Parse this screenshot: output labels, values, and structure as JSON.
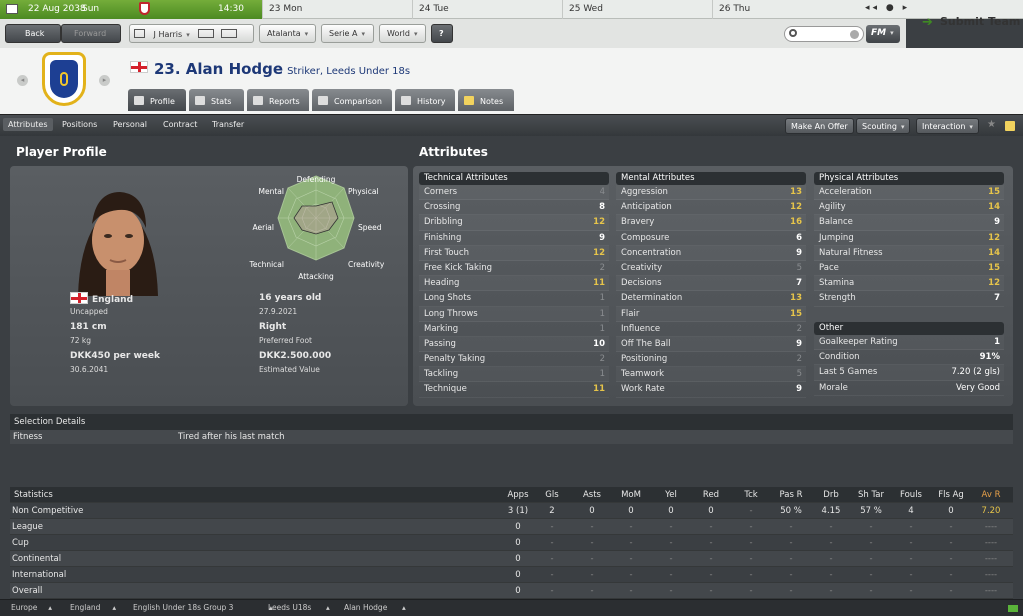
{
  "calendar": {
    "current_date": "22 Aug 2038",
    "current_day": "Sun",
    "time": "14:30",
    "days": [
      "23 Mon",
      "24 Tue",
      "25 Wed",
      "26 Thu"
    ]
  },
  "toolbar": {
    "back": "Back",
    "forward": "Forward",
    "manager": "J Harris",
    "club": "Atalanta",
    "league": "Serie A",
    "world": "World",
    "help": "?",
    "fm": "FM",
    "submit": "Submit Team"
  },
  "player": {
    "number_name": "23. Alan Hodge",
    "subtitle": "Striker, Leeds Under 18s"
  },
  "tabs": [
    "Profile",
    "Stats",
    "Reports",
    "Comparison",
    "History",
    "Notes"
  ],
  "subnav": {
    "items": [
      "Attributes",
      "Positions",
      "Personal",
      "Contract",
      "Transfer"
    ],
    "make_offer": "Make An Offer",
    "scouting": "Scouting",
    "interaction": "Interaction"
  },
  "profile": {
    "title": "Player Profile",
    "nation": "England",
    "caps": "Uncapped",
    "age": "16 years old",
    "dob": "27.9.2021",
    "height": "181 cm",
    "weight": "72 kg",
    "foot": "Right",
    "foot_label": "Preferred Foot",
    "wage": "DKK450 per week",
    "contract": "30.6.2041",
    "value": "DKK2.500.000",
    "value_label": "Estimated Value",
    "radar": {
      "labels": [
        "Defending",
        "Physical",
        "Speed",
        "Creativity",
        "Attacking",
        "Technical",
        "Aerial",
        "Mental"
      ]
    }
  },
  "attributes": {
    "title": "Attributes",
    "technical": {
      "header": "Technical Attributes",
      "items": [
        {
          "name": "Corners",
          "value": "4"
        },
        {
          "name": "Crossing",
          "value": "8"
        },
        {
          "name": "Dribbling",
          "value": "12"
        },
        {
          "name": "Finishing",
          "value": "9"
        },
        {
          "name": "First Touch",
          "value": "12"
        },
        {
          "name": "Free Kick Taking",
          "value": "2"
        },
        {
          "name": "Heading",
          "value": "11"
        },
        {
          "name": "Long Shots",
          "value": "1"
        },
        {
          "name": "Long Throws",
          "value": "1"
        },
        {
          "name": "Marking",
          "value": "1"
        },
        {
          "name": "Passing",
          "value": "10"
        },
        {
          "name": "Penalty Taking",
          "value": "2"
        },
        {
          "name": "Tackling",
          "value": "1"
        },
        {
          "name": "Technique",
          "value": "11"
        }
      ]
    },
    "mental": {
      "header": "Mental Attributes",
      "items": [
        {
          "name": "Aggression",
          "value": "13"
        },
        {
          "name": "Anticipation",
          "value": "12"
        },
        {
          "name": "Bravery",
          "value": "16"
        },
        {
          "name": "Composure",
          "value": "6"
        },
        {
          "name": "Concentration",
          "value": "9"
        },
        {
          "name": "Creativity",
          "value": "5"
        },
        {
          "name": "Decisions",
          "value": "7"
        },
        {
          "name": "Determination",
          "value": "13"
        },
        {
          "name": "Flair",
          "value": "15"
        },
        {
          "name": "Influence",
          "value": "2"
        },
        {
          "name": "Off The Ball",
          "value": "9"
        },
        {
          "name": "Positioning",
          "value": "2"
        },
        {
          "name": "Teamwork",
          "value": "5"
        },
        {
          "name": "Work Rate",
          "value": "9"
        }
      ]
    },
    "physical": {
      "header": "Physical Attributes",
      "items": [
        {
          "name": "Acceleration",
          "value": "15"
        },
        {
          "name": "Agility",
          "value": "14"
        },
        {
          "name": "Balance",
          "value": "9"
        },
        {
          "name": "Jumping",
          "value": "12"
        },
        {
          "name": "Natural Fitness",
          "value": "14"
        },
        {
          "name": "Pace",
          "value": "15"
        },
        {
          "name": "Stamina",
          "value": "12"
        },
        {
          "name": "Strength",
          "value": "7"
        }
      ]
    },
    "other": {
      "header": "Other",
      "items": [
        {
          "name": "Goalkeeper Rating",
          "value": "1"
        },
        {
          "name": "Condition",
          "value": "91%"
        },
        {
          "name": "Last 5 Games",
          "value": "7.20 (2 gls)"
        },
        {
          "name": "Morale",
          "value": "Very Good"
        }
      ]
    }
  },
  "selection": {
    "header": "Selection Details",
    "label": "Fitness",
    "value": "Tired after his last match"
  },
  "stats": {
    "columns": [
      "Statistics",
      "Apps",
      "Gls",
      "Asts",
      "MoM",
      "Yel",
      "Red",
      "Tck",
      "Pas R",
      "Drb",
      "Sh Tar",
      "Fouls",
      "Fls Ag",
      "Av R"
    ],
    "rows": [
      [
        "Non Competitive",
        "3 (1)",
        "2",
        "0",
        "0",
        "0",
        "0",
        "-",
        "50 %",
        "4.15",
        "57 %",
        "4",
        "0",
        "7.20"
      ],
      [
        "League",
        "0",
        "-",
        "-",
        "-",
        "-",
        "-",
        "-",
        "-",
        "-",
        "-",
        "-",
        "-",
        "----"
      ],
      [
        "Cup",
        "0",
        "-",
        "-",
        "-",
        "-",
        "-",
        "-",
        "-",
        "-",
        "-",
        "-",
        "-",
        "----"
      ],
      [
        "Continental",
        "0",
        "-",
        "-",
        "-",
        "-",
        "-",
        "-",
        "-",
        "-",
        "-",
        "-",
        "-",
        "----"
      ],
      [
        "International",
        "0",
        "-",
        "-",
        "-",
        "-",
        "-",
        "-",
        "-",
        "-",
        "-",
        "-",
        "-",
        "----"
      ],
      [
        "Overall",
        "0",
        "-",
        "-",
        "-",
        "-",
        "-",
        "-",
        "-",
        "-",
        "-",
        "-",
        "-",
        "----"
      ]
    ]
  },
  "footer": {
    "crumbs": [
      "Europe",
      "England",
      "English Under 18s Group 3",
      "Leeds U18s",
      "Alan Hodge"
    ]
  }
}
